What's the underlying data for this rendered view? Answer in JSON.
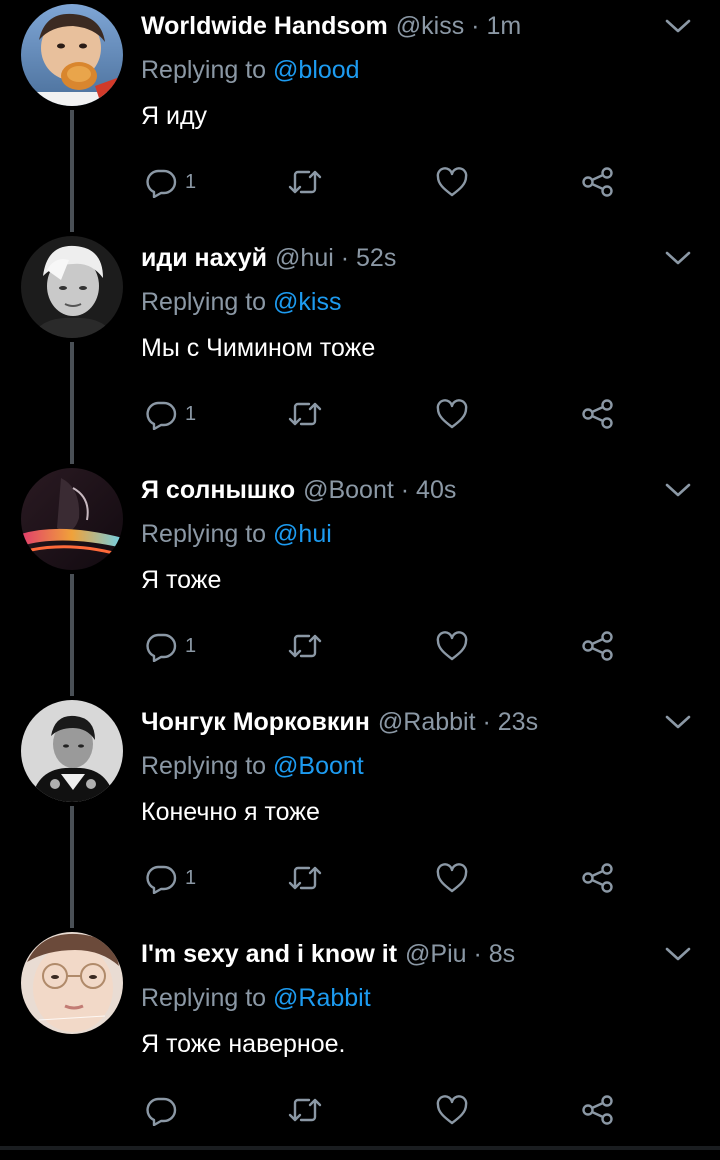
{
  "tweets": [
    {
      "name": "Worldwide Handsom",
      "handle": "@kiss",
      "dot": "·",
      "time": "1m",
      "reply_prefix": "Replying to",
      "reply_to": "@blood",
      "text": "Я иду",
      "reply_count": "1"
    },
    {
      "name": "иди нахуй",
      "handle": "@hui",
      "dot": "·",
      "time": "52s",
      "reply_prefix": "Replying to",
      "reply_to": "@kiss",
      "text": "Мы с Чимином тоже",
      "reply_count": "1"
    },
    {
      "name": "Я солнышко",
      "handle": "@Boont",
      "dot": "·",
      "time": "40s",
      "reply_prefix": "Replying to",
      "reply_to": "@hui",
      "text": "Я тоже",
      "reply_count": "1"
    },
    {
      "name": "Чонгук Морковкин",
      "handle": "@Rabbit",
      "dot": "·",
      "time": "23s",
      "reply_prefix": "Replying to",
      "reply_to": "@Boont",
      "text": "Конечно я тоже",
      "reply_count": "1"
    },
    {
      "name": "I'm sexy and i know it",
      "handle": "@Piu",
      "dot": "·",
      "time": "8s",
      "reply_prefix": "Replying to",
      "reply_to": "@Rabbit",
      "text": "Я тоже наверное.",
      "reply_count": ""
    }
  ],
  "colors": {
    "background": "#000000",
    "accent": "#1d9bf0",
    "secondary_text": "#8b98a5",
    "thread_line": "#4a5056"
  },
  "icons": {
    "reply": "reply-icon",
    "retweet": "retweet-icon",
    "like": "heart-icon",
    "share": "share-icon",
    "more": "chevron-down-icon"
  }
}
